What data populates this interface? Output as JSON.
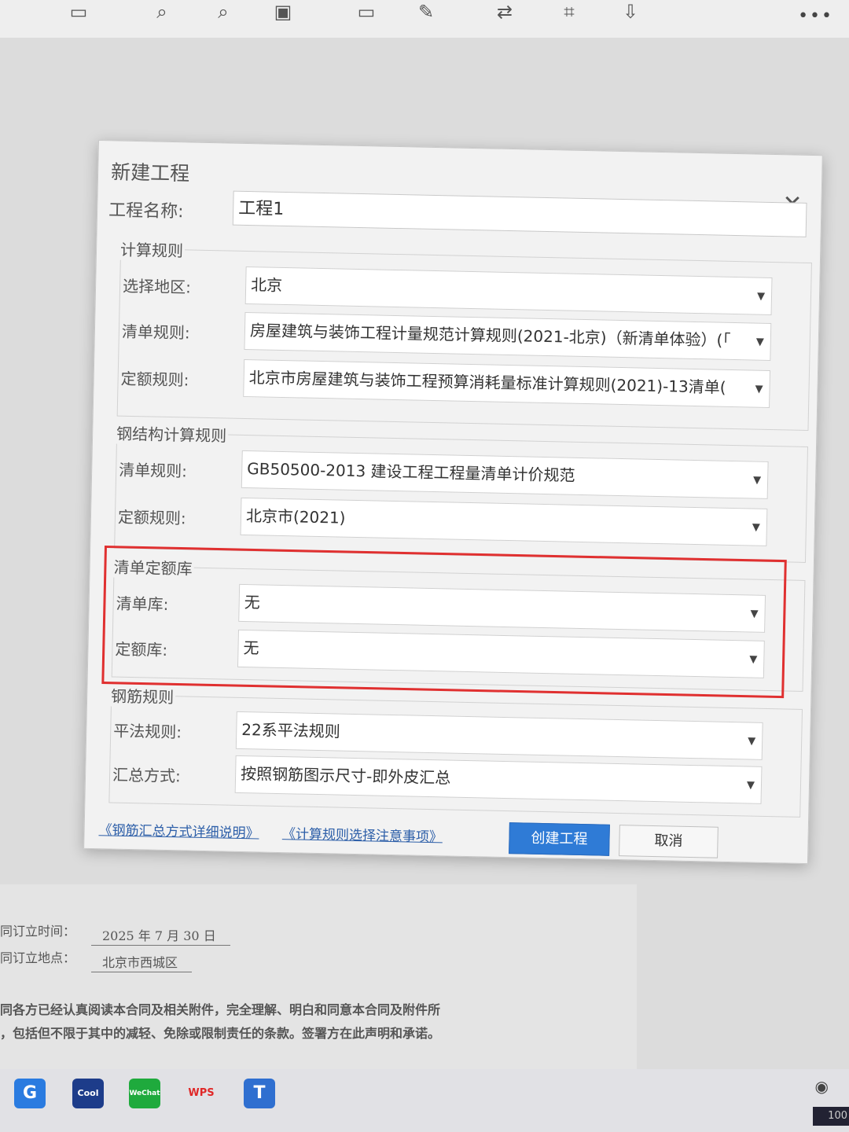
{
  "toolbar": {
    "icons": [
      "grid-icon",
      "search-icon",
      "zoom-icon",
      "page-icon",
      "frame-icon",
      "edit-icon",
      "translate-icon",
      "ocr-icon",
      "export-icon"
    ],
    "more_label": "•••"
  },
  "dialog": {
    "title": "新建工程",
    "project_name_label": "工程名称:",
    "project_name_value": "工程1",
    "calc_rules": {
      "section_label": "计算规则",
      "region_label": "选择地区:",
      "region_value": "北京",
      "bill_rule_label": "清单规则:",
      "bill_rule_value": "房屋建筑与装饰工程计量规范计算规则(2021-北京)（新清单体验）(「",
      "quota_rule_label": "定额规则:",
      "quota_rule_value": "北京市房屋建筑与装饰工程预算消耗量标准计算规则(2021)-13清单("
    },
    "steel_rules": {
      "section_label": "钢结构计算规则",
      "bill_rule_label": "清单规则:",
      "bill_rule_value": "GB50500-2013 建设工程工程量清单计价规范",
      "quota_rule_label": "定额规则:",
      "quota_rule_value": "北京市(2021)"
    },
    "library": {
      "section_label": "清单定额库",
      "bill_lib_label": "清单库:",
      "bill_lib_value": "无",
      "quota_lib_label": "定额库:",
      "quota_lib_value": "无"
    },
    "rebar_rules": {
      "section_label": "钢筋规则",
      "flat_rule_label": "平法规则:",
      "flat_rule_value": "22系平法规则",
      "summary_label": "汇总方式:",
      "summary_value": "按照钢筋图示尺寸-即外皮汇总"
    },
    "link_rebar_summary": "《钢筋汇总方式详细说明》",
    "link_calc_notes": "《计算规则选择注意事项》",
    "create_label": "创建工程",
    "cancel_label": "取消"
  },
  "document": {
    "sign_time_label": "同订立时间：",
    "sign_time_value": "2025 年 7 月 30 日",
    "sign_place_label": "同订立地点：",
    "sign_place_value": "北京市西城区",
    "para_line1": "同各方已经认真阅读本合同及相关附件，完全理解、明白和同意本合同及附件所",
    "para_line2": "，包括但不限于其中的减轻、免除或限制责任的条款。签署方在此声明和承诺。"
  },
  "taskbar": {
    "apps": [
      "G",
      "Cool",
      "WeChat",
      "WPS",
      "T"
    ],
    "battery": "100"
  },
  "colors": {
    "highlight_border": "#e03030",
    "primary_button": "#2f7bd6",
    "link": "#2c5ea8"
  }
}
